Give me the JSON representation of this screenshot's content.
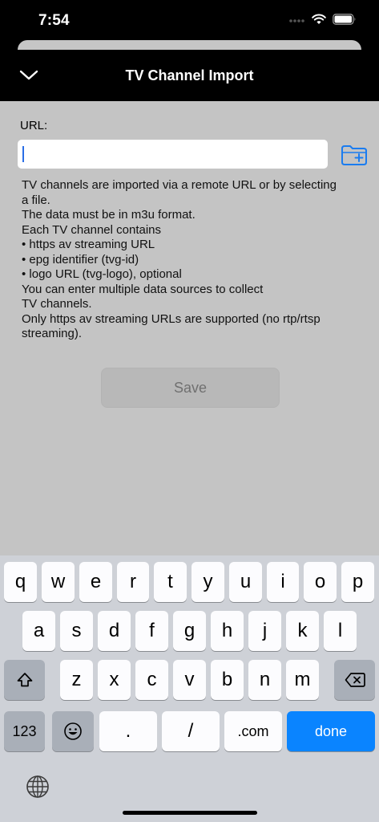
{
  "status_bar": {
    "time": "7:54"
  },
  "nav": {
    "title": "TV Channel Import",
    "back_icon": "chevron-down-icon"
  },
  "form": {
    "url_label": "URL:",
    "url_value": "",
    "folder_icon": "folder-add-icon",
    "info_lines": [
      "TV channels are imported via a remote URL or by selecting",
      "a file.",
      "The data must be in m3u format.",
      "Each TV channel contains",
      "• https av streaming URL",
      "• epg identifier (tvg-id)",
      "• logo URL (tvg-logo), optional",
      "You can enter multiple data sources to collect",
      "TV channels.",
      "Only https av streaming URLs are supported (no rtp/rtsp",
      "streaming)."
    ],
    "save_label": "Save"
  },
  "keyboard": {
    "row1": [
      "q",
      "w",
      "e",
      "r",
      "t",
      "y",
      "u",
      "i",
      "o",
      "p"
    ],
    "row2": [
      "a",
      "s",
      "d",
      "f",
      "g",
      "h",
      "j",
      "k",
      "l"
    ],
    "row3": [
      "z",
      "x",
      "c",
      "v",
      "b",
      "n",
      "m"
    ],
    "numbers_label": "123",
    "dot_label": ".",
    "slash_label": "/",
    "com_label": ".com",
    "done_label": "done"
  },
  "colors": {
    "accent": "#0a84ff",
    "background": "#c4c4c4",
    "nav": "#000000",
    "keyboard": "#ced1d7"
  }
}
